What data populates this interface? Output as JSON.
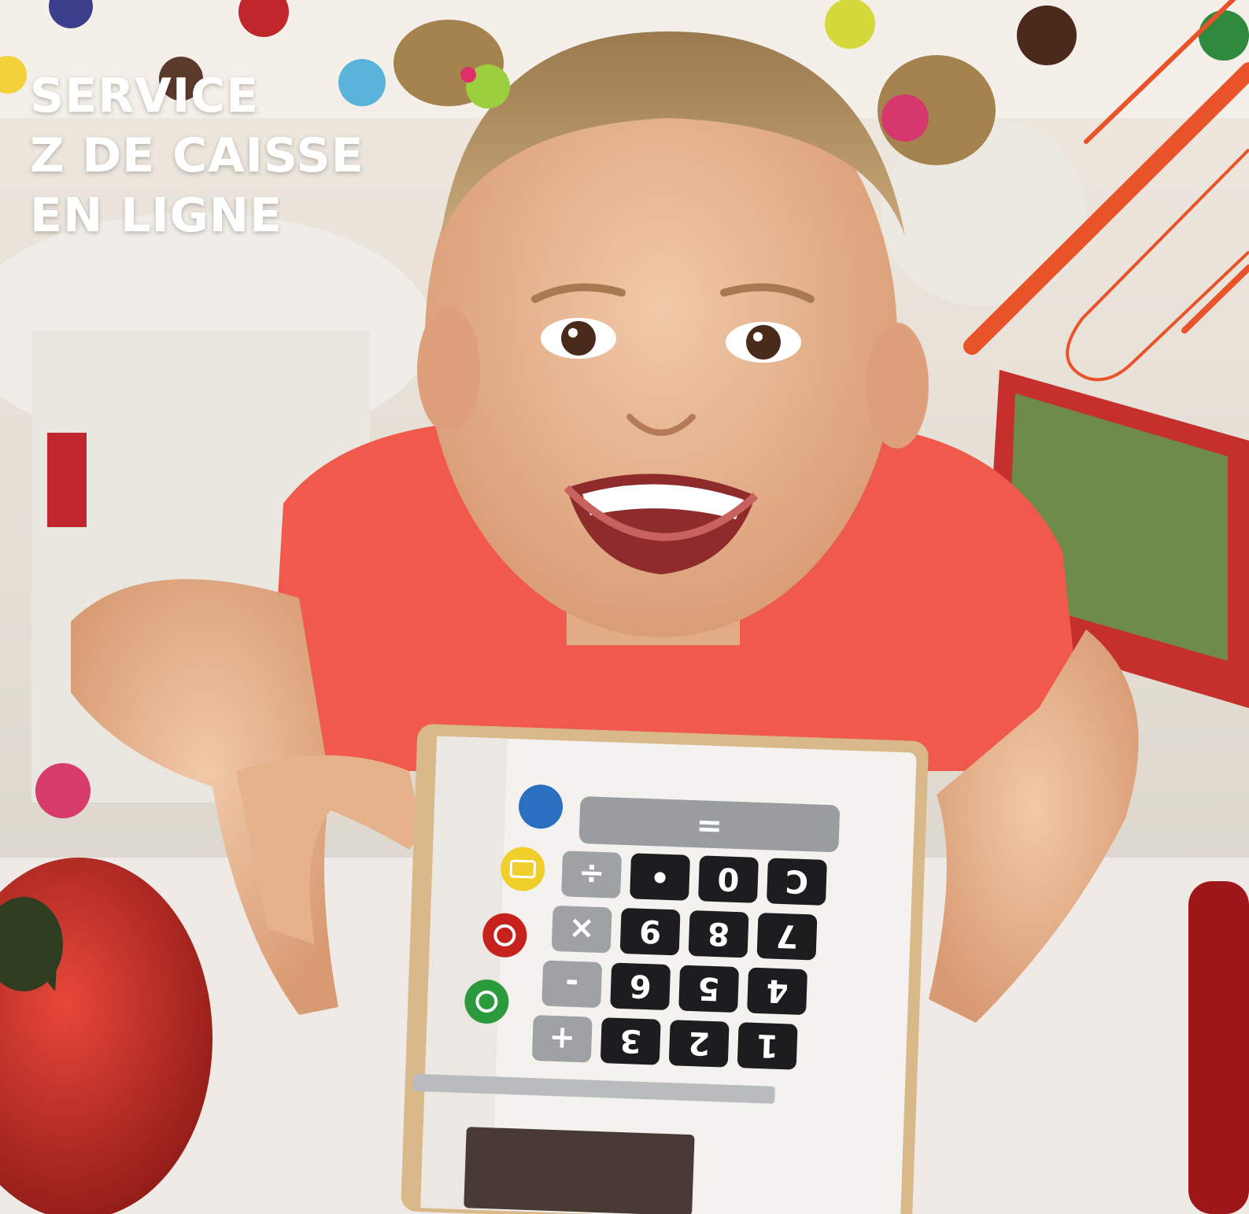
{
  "headline": {
    "line1": "SERVICE",
    "line2": "Z DE CAISSE",
    "line3": "EN LIGNE"
  },
  "calculator": {
    "display_key": "=",
    "rows": [
      [
        "÷",
        "•",
        "0",
        "C"
      ],
      [
        "×",
        "9",
        "8",
        "7"
      ],
      [
        "-",
        "6",
        "5",
        "4"
      ],
      [
        "+",
        "3",
        "2",
        "1"
      ]
    ],
    "side_buttons": [
      "coins-icon",
      "card-icon",
      "power-icon",
      "power-icon"
    ]
  },
  "colors": {
    "accent_orange": "#e8532a",
    "shirt": "#ef5a4c",
    "headline_text": "#ffffff"
  }
}
